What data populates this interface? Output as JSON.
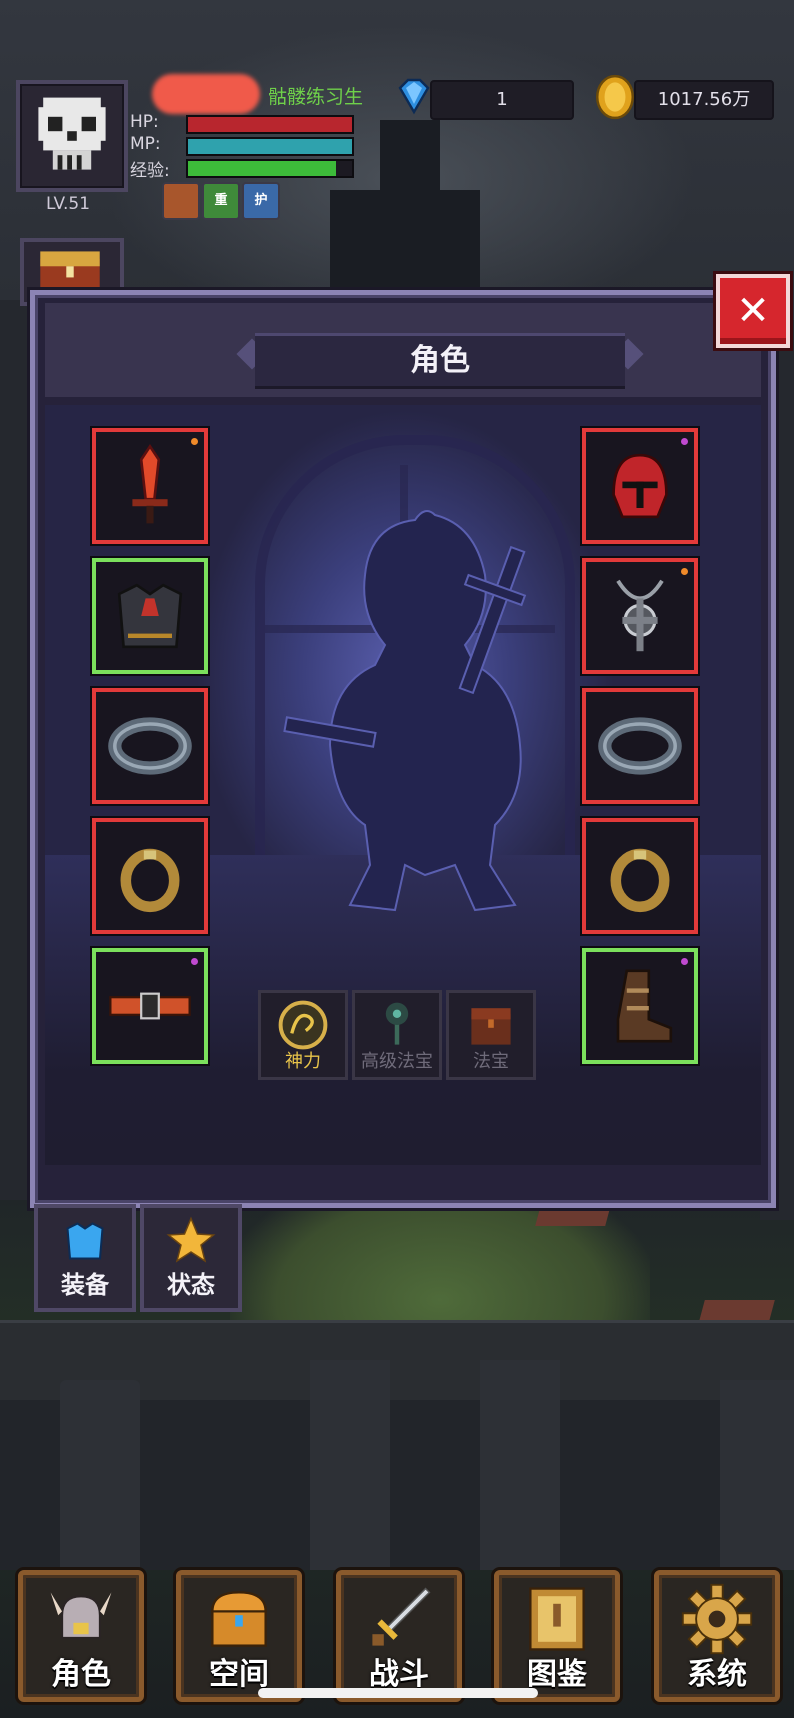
{
  "player": {
    "level": "LV.51",
    "title": "骷髅练习生",
    "hp_label": "HP:",
    "mp_label": "MP:",
    "exp_label": "经验:",
    "hp_fraction": 1.0,
    "mp_fraction": 1.0,
    "exp_fraction": 0.9
  },
  "buffs": [
    {
      "icon": "fist-buff-icon",
      "text": "",
      "color": "#a8562c"
    },
    {
      "icon": "heavy-buff-icon",
      "text": "重",
      "color": "#3f8a3a"
    },
    {
      "icon": "shield-buff-icon",
      "text": "护",
      "color": "#3a69a8"
    }
  ],
  "resources": {
    "gems": "1",
    "gold": "1017.56万"
  },
  "panel": {
    "title": "角色"
  },
  "equipment_left": [
    {
      "name": "sword-slot",
      "icon": "flame-sword-icon",
      "quality": "red",
      "dot": "#f08a2a"
    },
    {
      "name": "armor-slot",
      "icon": "dark-armor-icon",
      "quality": "green",
      "dot": ""
    },
    {
      "name": "bracer-slot-left",
      "icon": "bracer-icon",
      "quality": "red",
      "dot": ""
    },
    {
      "name": "ring-slot-left",
      "icon": "ring-icon",
      "quality": "red",
      "dot": ""
    },
    {
      "name": "belt-slot",
      "icon": "belt-icon",
      "quality": "green",
      "dot": "#c04ad0"
    }
  ],
  "equipment_right": [
    {
      "name": "helmet-slot",
      "icon": "red-helmet-icon",
      "quality": "red",
      "dot": "#c04ad0"
    },
    {
      "name": "necklace-slot",
      "icon": "amulet-icon",
      "quality": "red",
      "dot": "#f08a2a"
    },
    {
      "name": "bracer-slot-right",
      "icon": "bracer-icon",
      "quality": "red",
      "dot": ""
    },
    {
      "name": "ring-slot-right",
      "icon": "ring-icon",
      "quality": "red",
      "dot": ""
    },
    {
      "name": "boots-slot",
      "icon": "boots-icon",
      "quality": "green",
      "dot": "#c04ad0"
    }
  ],
  "treasures": [
    {
      "label": "神力",
      "icon": "divine-power-icon",
      "color": "#e8c44a"
    },
    {
      "label": "高级法宝",
      "icon": "advanced-treasure-icon",
      "color": "#6f6b7a"
    },
    {
      "label": "法宝",
      "icon": "treasure-icon",
      "color": "#6f6b7a"
    }
  ],
  "side_tabs": [
    {
      "label": "装备",
      "icon": "armor-tab-icon"
    },
    {
      "label": "状态",
      "icon": "star-tab-icon"
    }
  ],
  "bottom_nav": [
    {
      "label": "角色",
      "icon": "horned-helmet-icon"
    },
    {
      "label": "空间",
      "icon": "chest-icon"
    },
    {
      "label": "战斗",
      "icon": "sword-icon"
    },
    {
      "label": "图鉴",
      "icon": "book-icon"
    },
    {
      "label": "系统",
      "icon": "gear-icon"
    }
  ]
}
